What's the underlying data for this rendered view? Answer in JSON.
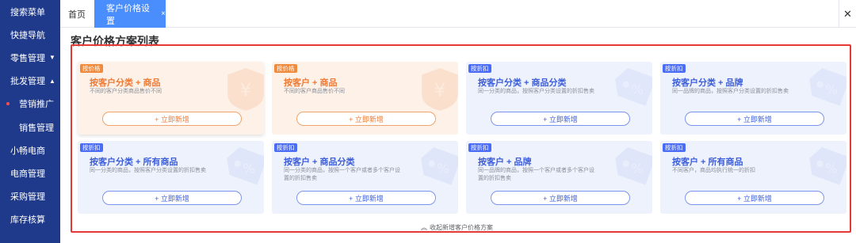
{
  "sidebar": {
    "items": [
      {
        "label": "搜索菜单",
        "sub": false,
        "arrow": "",
        "active": false
      },
      {
        "label": "快捷导航",
        "sub": false,
        "arrow": "",
        "active": false
      },
      {
        "label": "零售管理",
        "sub": false,
        "arrow": "▼",
        "active": false
      },
      {
        "label": "批发管理",
        "sub": false,
        "arrow": "▲",
        "active": false
      },
      {
        "label": "营销推广",
        "sub": true,
        "arrow": "",
        "active": true
      },
      {
        "label": "销售管理",
        "sub": true,
        "arrow": "",
        "active": false
      },
      {
        "label": "小畅电商",
        "sub": false,
        "arrow": "",
        "active": false
      },
      {
        "label": "电商管理",
        "sub": false,
        "arrow": "",
        "active": false
      },
      {
        "label": "采购管理",
        "sub": false,
        "arrow": "",
        "active": false
      },
      {
        "label": "库存核算",
        "sub": false,
        "arrow": "",
        "active": false
      }
    ],
    "background": "#1f3a8a"
  },
  "tabs": {
    "home_label": "首页",
    "active_label": "客户价格设置",
    "active_close": "×",
    "close_all": "✕"
  },
  "main": {
    "title": "客户价格方案列表",
    "collapse_label": "收起新增客户价格方案"
  },
  "cards": [
    {
      "badge": "按价格",
      "title": "按客户分类 + 商品",
      "desc": "不同的客户分类商品售价不同",
      "button": "+ 立即新增",
      "theme": "orange",
      "icon": "yen-tag-icon"
    },
    {
      "badge": "按价格",
      "title": "按客户 + 商品",
      "desc": "不同的客户商品售价不同",
      "button": "+ 立即新增",
      "theme": "orange",
      "icon": "yen-tag-icon"
    },
    {
      "badge": "按折扣",
      "title": "按客户分类 + 商品分类",
      "desc": "同一分类的商品，按照客户分类设置的折扣售卖",
      "button": "+ 立即新增",
      "theme": "blue",
      "icon": "discount-tag-icon"
    },
    {
      "badge": "按折扣",
      "title": "按客户分类 + 品牌",
      "desc": "同一品牌的商品，按照客户分类设置的折扣售卖",
      "button": "+ 立即新增",
      "theme": "blue",
      "icon": "discount-tag-icon"
    },
    {
      "badge": "按折扣",
      "title": "按客户分类 + 所有商品",
      "desc": "同一分类的商品，按照客户分类设置的折扣售卖",
      "button": "+ 立即新增",
      "theme": "blue",
      "icon": "discount-tag-icon"
    },
    {
      "badge": "按折扣",
      "title": "按客户 + 商品分类",
      "desc": "同一分类的商品，按照一个客户或者多个客户设置的折扣售卖",
      "button": "+ 立即新增",
      "theme": "blue",
      "icon": "discount-tag-icon"
    },
    {
      "badge": "按折扣",
      "title": "按客户 + 品牌",
      "desc": "同一品牌的商品，按照一个客户或者多个客户设置的折扣售卖",
      "button": "+ 立即新增",
      "theme": "blue",
      "icon": "discount-tag-icon"
    },
    {
      "badge": "按折扣",
      "title": "按客户 + 所有商品",
      "desc": "不同客户，商品均执行统一的折扣",
      "button": "+ 立即新增",
      "theme": "blue",
      "icon": "discount-tag-icon"
    }
  ],
  "colors": {
    "accent_blue": "#4a8dfc",
    "orange": "#ee7a35",
    "blue": "#3d5ed9",
    "highlight_frame": "#e53935"
  }
}
